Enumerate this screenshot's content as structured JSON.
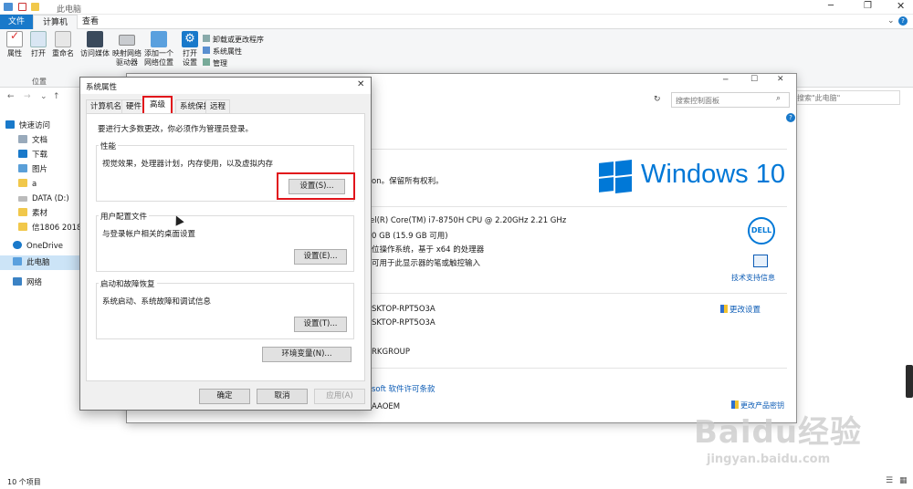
{
  "explorer": {
    "title": "此电脑",
    "tabs": [
      "文件",
      "计算机",
      "查看"
    ],
    "ribbon": {
      "properties": "属性",
      "open": "打开",
      "rename": "重命名",
      "access_media": "访问媒体",
      "map_drive": "映射网络",
      "map_drive_2": "驱动器",
      "add_location": "添加一个",
      "add_location_2": "网络位置",
      "open_settings": "打开",
      "open_settings_2": "设置",
      "uninstall": "卸载或更改程序",
      "system_properties": "系统属性",
      "manage": "管理",
      "group_location": "位置"
    },
    "search_placeholder": "搜索\"此电脑\"",
    "nav": [
      "快速访问",
      "文档",
      "下载",
      "图片",
      "a",
      "DATA (D:)",
      "素材",
      "信1806 201836",
      "OneDrive",
      "此电脑",
      "网络"
    ],
    "status": "10 个项目"
  },
  "control_panel": {
    "search_placeholder": "搜索控制面板",
    "copyright_tail": "on。保留所有权利。",
    "windows_logo_text": "Windows 10",
    "processor": "el(R) Core(TM) i7-8750H CPU @ 2.20GHz   2.21 GHz",
    "ram": "0 GB (15.9 GB 可用)",
    "system_type": "位操作系统，基于 x64 的处理器",
    "pen_touch": "可用于此显示器的笔或触控输入",
    "support_link": "技术支持信息",
    "computer_name": "SKTOP-RPT5O3A",
    "full_name": "SKTOP-RPT5O3A",
    "workgroup": "RKGROUP",
    "change_settings": "更改设置",
    "license_link": "soft 软件许可条款",
    "product_id": "AAOEM",
    "change_product_key": "更改产品密钥",
    "dell_label": "DELL"
  },
  "dialog": {
    "title": "系统属性",
    "tabs": [
      "计算机名",
      "硬件",
      "高级",
      "系统保护",
      "远程"
    ],
    "admin_note": "要进行大多数更改，你必须作为管理员登录。",
    "performance": {
      "label": "性能",
      "desc": "视觉效果，处理器计划，内存使用，以及虚拟内存",
      "button": "设置(S)..."
    },
    "profiles": {
      "label": "用户配置文件",
      "desc": "与登录帐户相关的桌面设置",
      "button": "设置(E)..."
    },
    "startup": {
      "label": "启动和故障恢复",
      "desc": "系统启动、系统故障和调试信息",
      "button": "设置(T)..."
    },
    "env_button": "环境变量(N)...",
    "ok": "确定",
    "cancel": "取消",
    "apply": "应用(A)"
  },
  "watermark": {
    "brand": "Baidu经验",
    "url": "jingyan.baidu.com"
  },
  "colors": {
    "accent": "#1979ca",
    "highlight": "#e1141b",
    "win_blue": "#0078d7",
    "link": "#0b5bb5"
  }
}
